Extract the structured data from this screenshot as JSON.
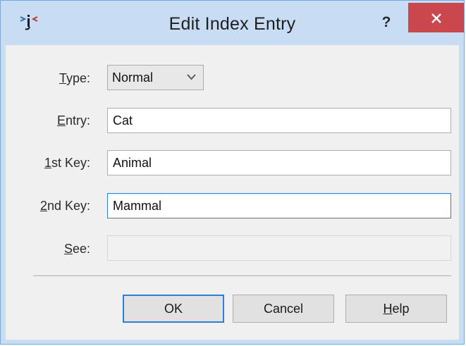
{
  "window": {
    "title": "Edit Index Entry",
    "help_glyph": "?",
    "close_icon": "close-icon",
    "app_icon": "app-logo-icon",
    "accent_color": "#2b7fd8",
    "close_color": "#c9474d"
  },
  "form": {
    "type": {
      "label_key": "T",
      "label_rest": "ype:",
      "value": "Normal"
    },
    "entry": {
      "label_key": "E",
      "label_rest": "ntry:",
      "value": "Cat"
    },
    "key1": {
      "label_key": "1",
      "label_rest": "st Key:",
      "value": "Animal"
    },
    "key2": {
      "label_key": "2",
      "label_rest": "nd Key:",
      "value": "Mammal"
    },
    "see": {
      "label_key": "S",
      "label_rest": "ee:",
      "value": ""
    }
  },
  "buttons": {
    "ok": "OK",
    "cancel": "Cancel",
    "help_key": "H",
    "help_rest": "elp"
  }
}
